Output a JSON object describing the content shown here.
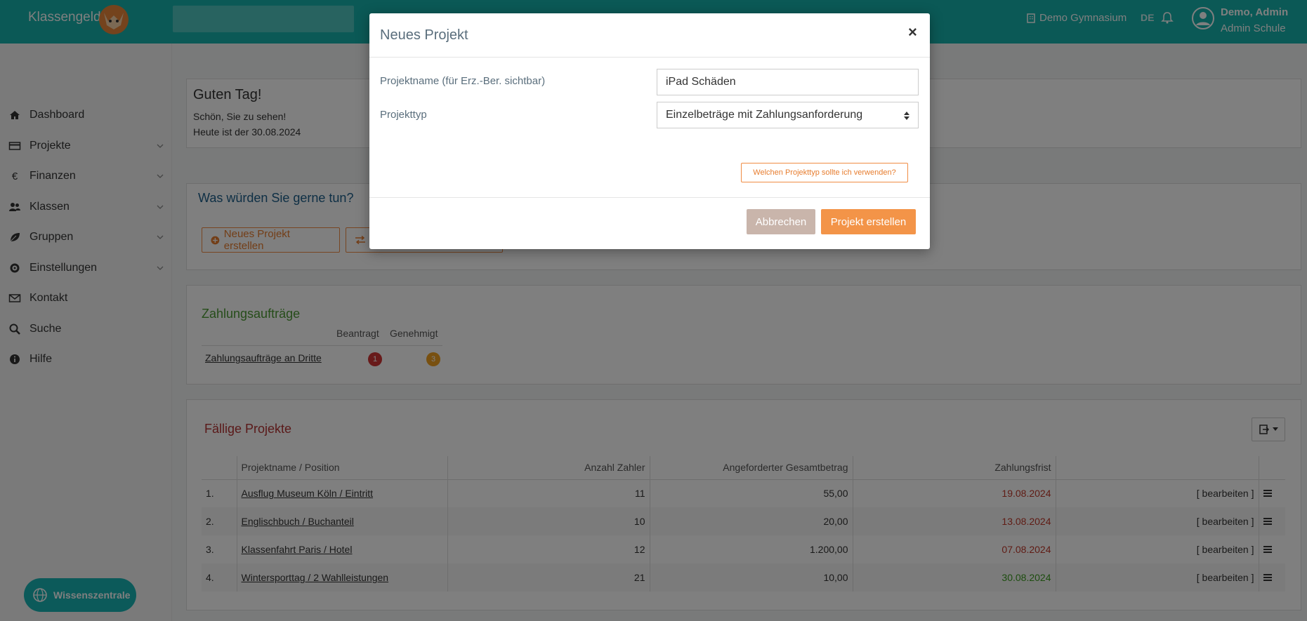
{
  "header": {
    "logo_text": "Klassengeld",
    "school": "Demo Gymnasium",
    "language": "DE",
    "user_name": "Demo, Admin",
    "user_role": "Admin Schule"
  },
  "sidebar": {
    "items": [
      {
        "label": "Dashboard",
        "icon": "home-icon",
        "has_chevron": false
      },
      {
        "label": "Projekte",
        "icon": "credit-card-icon",
        "has_chevron": true
      },
      {
        "label": "Finanzen",
        "icon": "euro-icon",
        "has_chevron": true
      },
      {
        "label": "Klassen",
        "icon": "users-icon",
        "has_chevron": true
      },
      {
        "label": "Gruppen",
        "icon": "leaf-icon",
        "has_chevron": true
      },
      {
        "label": "Einstellungen",
        "icon": "gear-icon",
        "has_chevron": true
      },
      {
        "label": "Kontakt",
        "icon": "envelope-icon",
        "has_chevron": false
      },
      {
        "label": "Suche",
        "icon": "search-icon",
        "has_chevron": false
      },
      {
        "label": "Hilfe",
        "icon": "info-icon",
        "has_chevron": false
      }
    ],
    "wissen_label": "Wissenszentrale"
  },
  "greeting": {
    "title": "Guten Tag!",
    "line1": "Schön, Sie zu sehen!",
    "line2": "Heute ist der 30.08.2024"
  },
  "actions": {
    "title": "Was würden Sie gerne tun?",
    "new_project": "Neues Projekt erstellen"
  },
  "zahlungsauftraege": {
    "title": "Zahlungsaufträge",
    "col_beantragt": "Beantragt",
    "col_genehmigt": "Genehmigt",
    "row_label": "Zahlungsaufträge an Dritte",
    "beantragt": "1",
    "genehmigt": "3"
  },
  "faellige": {
    "title": "Fällige Projekte",
    "columns": [
      "",
      "Projektname / Position",
      "Anzahl Zahler",
      "Angeforderter Gesamtbetrag",
      "Zahlungsfrist",
      ""
    ],
    "rows": [
      {
        "nr": "1.",
        "name": "Ausflug Museum Köln / Eintritt",
        "zahler": "11",
        "betrag": "55,00",
        "frist": "19.08.2024",
        "frist_color": "#c0392b",
        "action": "[ bearbeiten ]"
      },
      {
        "nr": "2.",
        "name": "Englischbuch / Buchanteil",
        "zahler": "10",
        "betrag": "20,00",
        "frist": "13.08.2024",
        "frist_color": "#c0392b",
        "action": "[ bearbeiten ]"
      },
      {
        "nr": "3.",
        "name": "Klassenfahrt Paris / Hotel",
        "zahler": "12",
        "betrag": "1.200,00",
        "frist": "07.08.2024",
        "frist_color": "#c0392b",
        "action": "[ bearbeiten ]"
      },
      {
        "nr": "4.",
        "name": "Wintersporttag / 2 Wahlleistungen",
        "zahler": "21",
        "betrag": "10,00",
        "frist": "30.08.2024",
        "frist_color": "#3a9a1f",
        "action": "[ bearbeiten ]"
      }
    ]
  },
  "modal": {
    "title": "Neues Projekt",
    "close": "×",
    "name_label": "Projektname (für Erz.-Ber. sichtbar)",
    "name_value": "iPad Schäden",
    "type_label": "Projekttyp",
    "type_value": "Einzelbeträge mit Zahlungsanforderung",
    "help_button": "Welchen Projekttyp sollte ich verwenden?",
    "cancel": "Abbrechen",
    "create": "Projekt erstellen"
  },
  "colors": {
    "brand": "#16b3ad",
    "accent": "#f39448",
    "danger": "#c0392b",
    "success": "#3a9a1f"
  }
}
